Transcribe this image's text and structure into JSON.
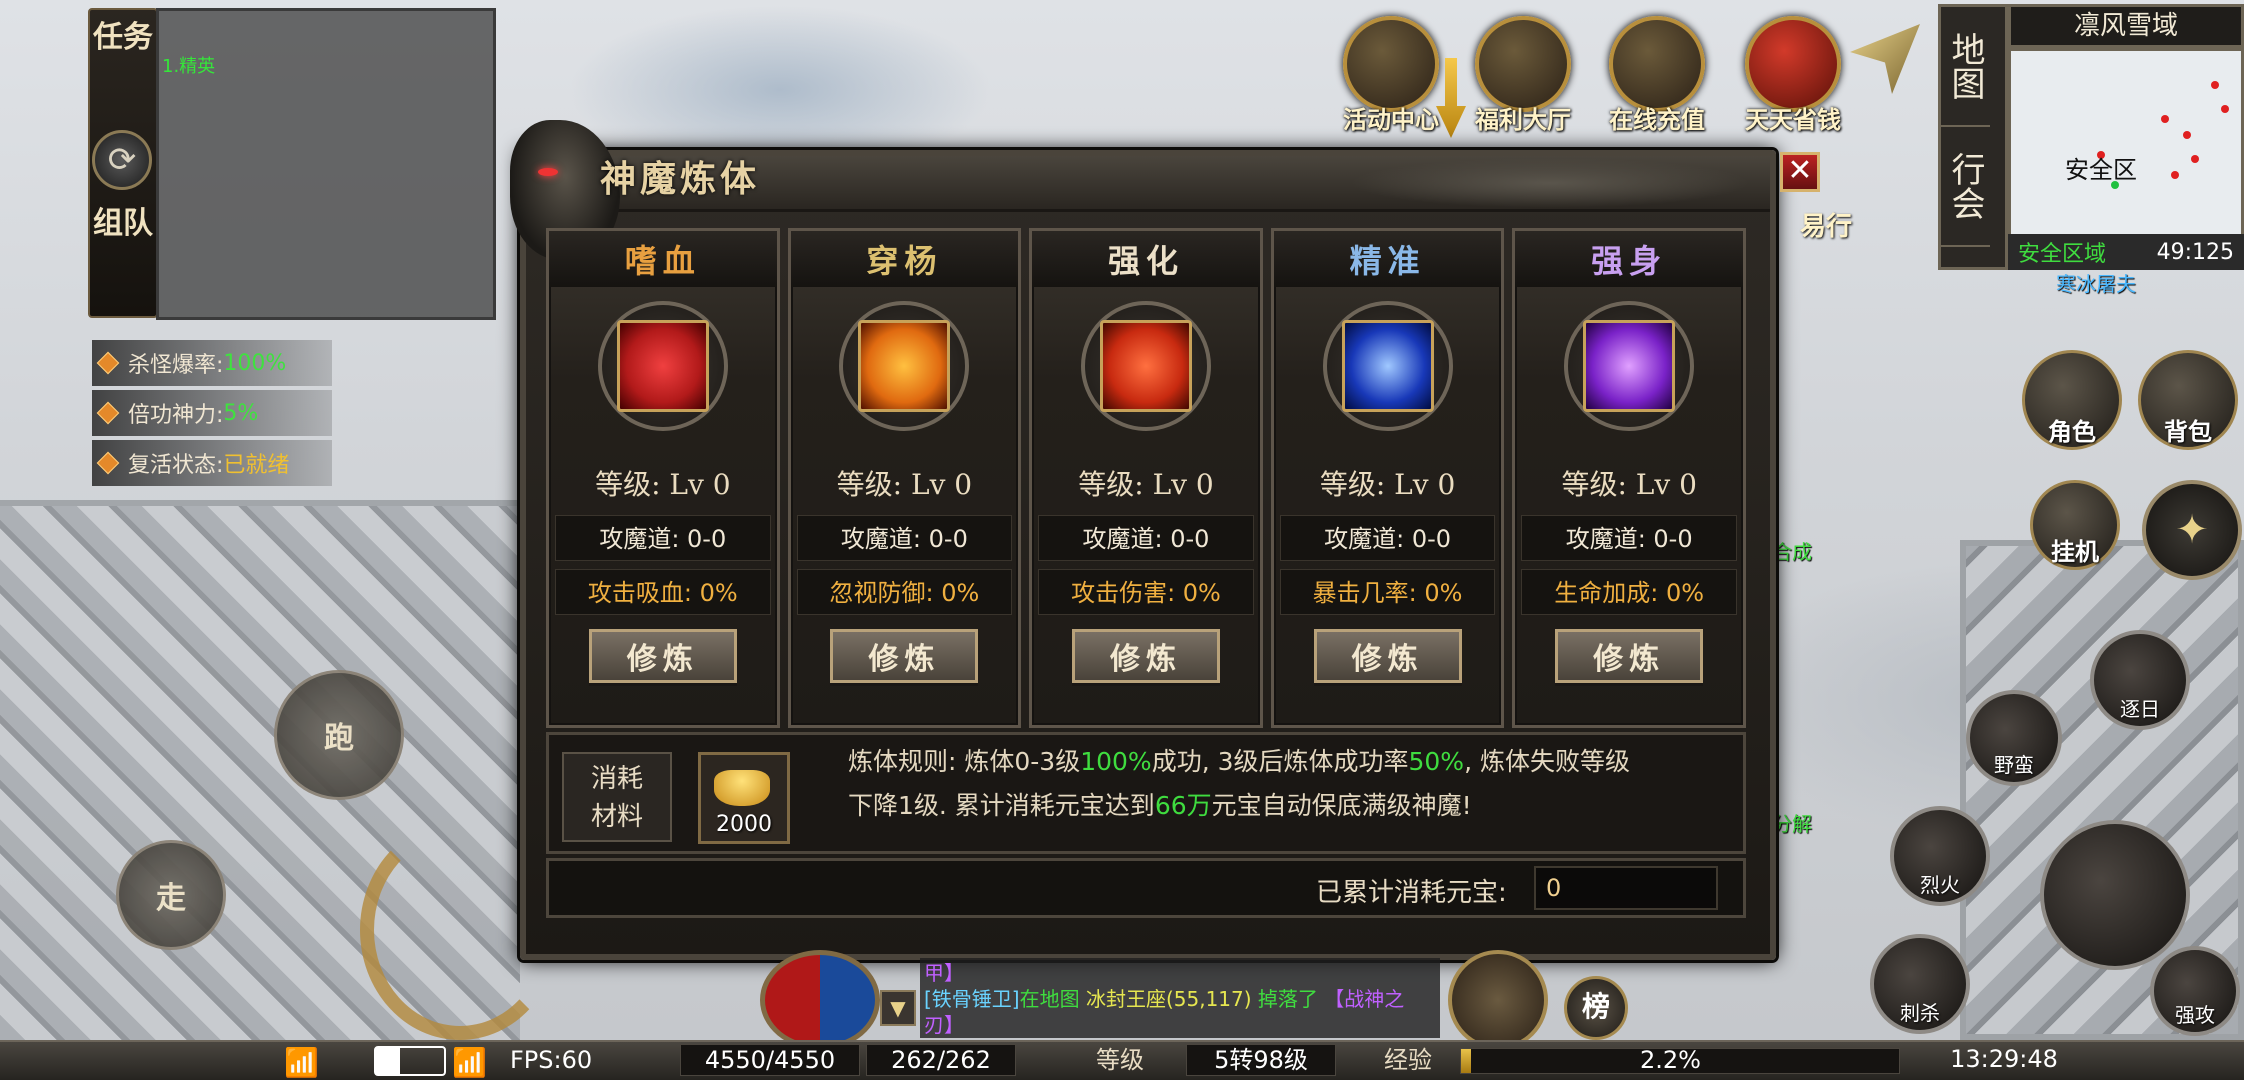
{
  "quest_panel": {
    "tabs": [
      "任务",
      "组队"
    ],
    "green_text": "1.精英",
    "stats": [
      {
        "label": "杀怪爆率:",
        "value": "100%"
      },
      {
        "label": "倍功神力:",
        "value": "5%"
      },
      {
        "label": "复活状态:",
        "value": "已就绪"
      }
    ]
  },
  "joystick": {
    "run": "跑",
    "walk": "走"
  },
  "top_icons": [
    "活动中心",
    "福利大厅",
    "在线充值",
    "天天省钱"
  ],
  "partial_icon_label": "易行",
  "map": {
    "tabs": [
      "地图",
      "行会"
    ],
    "title": "凛风雪域",
    "safe_label": "安全区",
    "zone": "安全区域",
    "coords": "49:125",
    "npc_label": "寒冰屠夫"
  },
  "right_buttons": [
    "角色",
    "背包",
    "挂机"
  ],
  "skills": [
    "逐日",
    "野蛮",
    "烈火",
    "刺杀",
    "强攻"
  ],
  "side_labels": [
    "合成",
    "分解"
  ],
  "small_buttons": [
    "榜"
  ],
  "dialog": {
    "title": "神魔炼体",
    "close": "✕",
    "columns": [
      {
        "name": "嗜血",
        "color": "#e8a040",
        "icon_color": "#b21a1a",
        "level": "等级: Lv 0",
        "attack": "攻魔道: 0-0",
        "attr": "攻击吸血: 0%",
        "button": "修炼"
      },
      {
        "name": "穿杨",
        "color": "#dcc070",
        "icon_color": "#e06a10",
        "level": "等级: Lv 0",
        "attack": "攻魔道: 0-0",
        "attr": "忽视防御: 0%",
        "button": "修炼"
      },
      {
        "name": "强化",
        "color": "#ece0c8",
        "icon_color": "#c82a10",
        "level": "等级: Lv 0",
        "attack": "攻魔道: 0-0",
        "attr": "攻击伤害: 0%",
        "button": "修炼"
      },
      {
        "name": "精准",
        "color": "#8ab8e8",
        "icon_color": "#1838b8",
        "level": "等级: Lv 0",
        "attack": "攻魔道: 0-0",
        "attr": "暴击几率: 0%",
        "button": "修炼"
      },
      {
        "name": "强身",
        "color": "#c8a0f0",
        "icon_color": "#7a22c8",
        "level": "等级: Lv 0",
        "attack": "攻魔道: 0-0",
        "attr": "生命加成: 0%",
        "button": "修炼"
      }
    ],
    "cost_label_1": "消耗",
    "cost_label_2": "材料",
    "cost_amount": "2000",
    "rules_1a": "炼体规则: 炼体0-3级",
    "rules_1b": "100%",
    "rules_1c": "成功, 3级后炼体成功率",
    "rules_1d": "50%",
    "rules_1e": ", 炼体失败等级",
    "rules_2a": "下降1级. 累计消耗元宝达到",
    "rules_2b": "66万",
    "rules_2c": "元宝自动保底满级神魔!",
    "total_label": "已累计消耗元宝:",
    "total_value": "0"
  },
  "chat": {
    "line1": "甲】",
    "line2_player": "[铁骨锤卫]",
    "line2_mid": "在地图",
    "line2_map": "冰封王座(55,117)",
    "line2_end": "掉落了",
    "line2_item": "【战神之",
    "line3": "刃】"
  },
  "bottom_bar": {
    "fps": "FPS:60",
    "hp": "4550/4550",
    "mp": "262/262",
    "level_label": "等级",
    "level_value": "5转98级",
    "exp_label": "经验",
    "exp_value": "2.2%",
    "exp_fraction": 0.022,
    "time": "13:29:48"
  }
}
